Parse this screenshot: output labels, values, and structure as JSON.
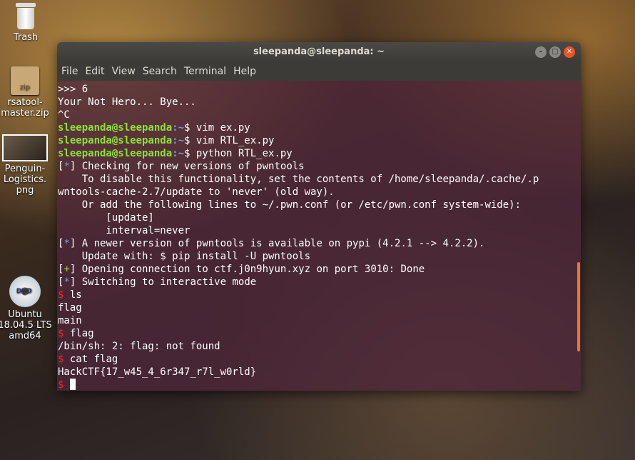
{
  "desktop": {
    "icons": [
      {
        "label": "Trash"
      },
      {
        "label": "rsatool-\nmaster.zip"
      },
      {
        "label": "Penguin-\nLogistics.\npng"
      },
      {
        "label": "Ubuntu\n18.04.5 LTS\namd64"
      }
    ],
    "zip_badge": "zip",
    "dvd_badge": "DVD"
  },
  "window": {
    "title": "sleepanda@sleepanda: ~",
    "menu": [
      "File",
      "Edit",
      "View",
      "Search",
      "Terminal",
      "Help"
    ]
  },
  "terminal": {
    "lines": [
      ">>> 6",
      "Your Not Hero... Bye...",
      "^C",
      {
        "user": "sleepanda@sleepanda",
        "path": ":~",
        "cmd": "$ vim ex.py"
      },
      {
        "user": "sleepanda@sleepanda",
        "path": ":~",
        "cmd": "$ vim RTL_ex.py"
      },
      {
        "user": "sleepanda@sleepanda",
        "path": ":~",
        "cmd": "$ python RTL_ex.py"
      },
      {
        "mark": "*",
        "text": " Checking for new versions of pwntools"
      },
      "    To disable this functionality, set the contents of /home/sleepanda/.cache/.p",
      "wntools-cache-2.7/update to 'never' (old way).",
      "    Or add the following lines to ~/.pwn.conf (or /etc/pwn.conf system-wide):",
      "        [update]",
      "        interval=never",
      {
        "mark": "*",
        "text": " A newer version of pwntools is available on pypi (4.2.1 --> 4.2.2)."
      },
      "    Update with: $ pip install -U pwntools",
      {
        "mark": "+",
        "text": " Opening connection to ctf.j0n9hyun.xyz on port 3010: Done"
      },
      {
        "mark": "*",
        "text": " Switching to interactive mode"
      },
      {
        "shell": "$",
        "text": " ls"
      },
      "flag",
      "main",
      {
        "shell": "$",
        "text": " flag"
      },
      "/bin/sh: 2: flag: not found",
      {
        "shell": "$",
        "text": " cat flag"
      },
      "HackCTF{17_w45_4_6r347_r7l_w0rld}",
      {
        "shell": "$",
        "text": " ",
        "cursor": true
      }
    ]
  }
}
